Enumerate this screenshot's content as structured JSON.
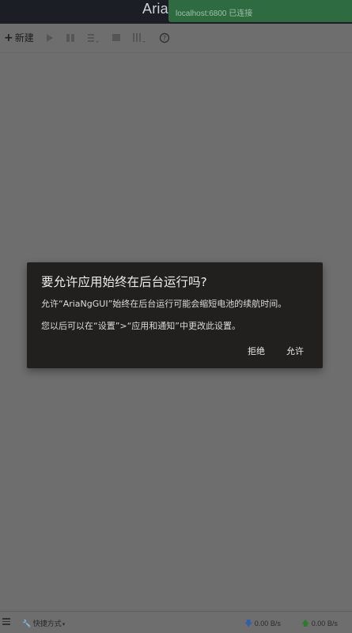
{
  "app": {
    "title": "AriaN"
  },
  "toast": {
    "text": "localhost:6800 已连接"
  },
  "toolbar": {
    "new_label": "新建",
    "icons": [
      "plus-icon",
      "play-icon",
      "pause-icon",
      "sort-icon",
      "stop-icon",
      "filter-icon",
      "help-icon"
    ]
  },
  "dialog": {
    "title": "要允许应用始终在后台运行吗?",
    "message1": "允许“AriaNgGUI”始终在后台运行可能会缩短电池的续航时间。",
    "message2": "您以后可以在“设置”>“应用和通知”中更改此设置。",
    "deny_label": "拒绝",
    "allow_label": "允许"
  },
  "statusbar": {
    "shortcut_label": "快捷方式",
    "download_speed": "0.00 B/s",
    "upload_speed": "0.00 B/s"
  },
  "colors": {
    "topbar": "#1b1e25",
    "toast": "#2f6b40",
    "overlay": "#6e6e6e",
    "dialog": "#221f1f",
    "download_arrow": "#2f5fae",
    "upload_arrow": "#2d7a2d"
  }
}
